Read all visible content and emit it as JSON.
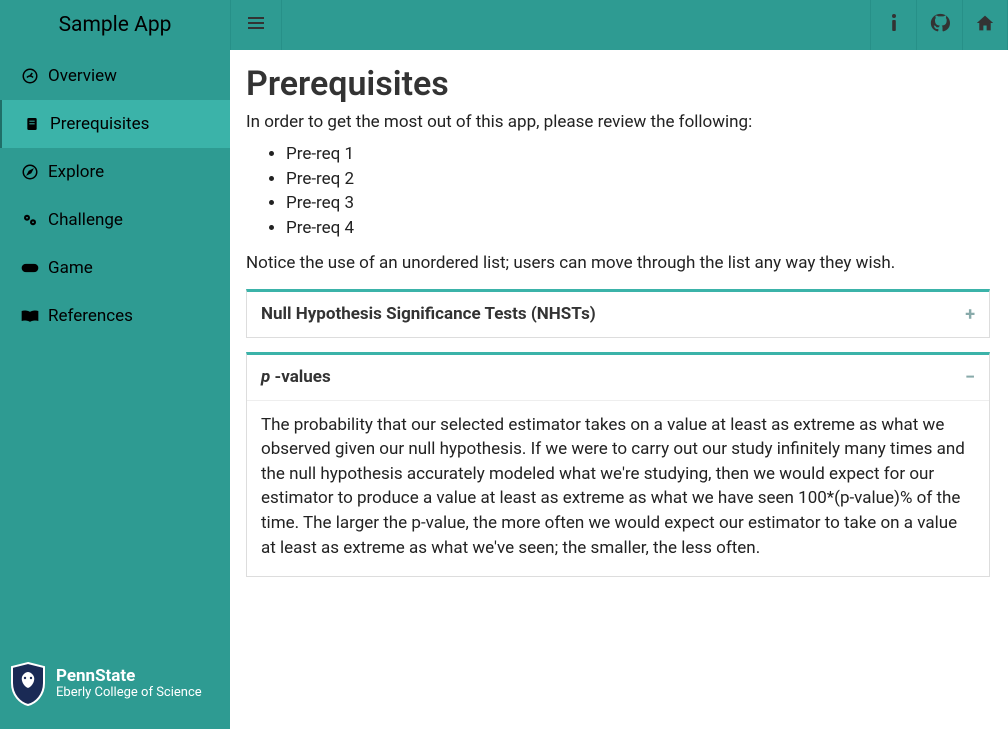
{
  "app": {
    "title": "Sample App"
  },
  "sidebar": {
    "items": [
      {
        "label": "Overview"
      },
      {
        "label": "Prerequisites"
      },
      {
        "label": "Explore"
      },
      {
        "label": "Challenge"
      },
      {
        "label": "Game"
      },
      {
        "label": "References"
      }
    ]
  },
  "logo": {
    "line1": "PennState",
    "line2": "Eberly College of Science"
  },
  "page": {
    "title": "Prerequisites",
    "intro": "In order to get the most out of this app, please review the following:",
    "prereqs": [
      "Pre-req 1",
      "Pre-req 2",
      "Pre-req 3",
      "Pre-req 4"
    ],
    "note": "Notice the use of an unordered list; users can move through the list any way they wish."
  },
  "panels": [
    {
      "title_html": "Null Hypothesis Significance Tests (NHSTs)",
      "collapsed": true,
      "toggle": "+",
      "body": ""
    },
    {
      "title_prefix_italic": "p",
      "title_rest": " -values",
      "collapsed": false,
      "toggle": "−",
      "body": "The probability that our selected estimator takes on a value at least as extreme as what we observed given our null hypothesis. If we were to carry out our study infinitely many times and the null hypothesis accurately modeled what we're studying, then we would expect for our estimator to produce a value at least as extreme as what we have seen 100*(p-value)% of the time. The larger the p-value, the more often we would expect our estimator to take on a value at least as extreme as what we've seen; the smaller, the less often."
    }
  ]
}
